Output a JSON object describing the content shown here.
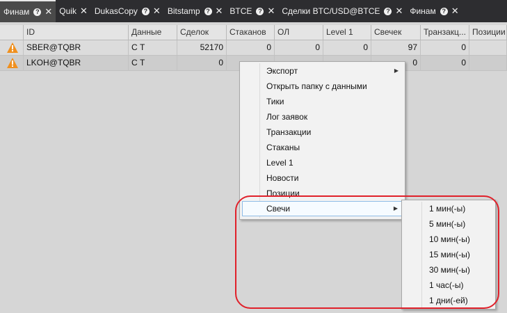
{
  "tabs": [
    {
      "label": "Финам",
      "active": true,
      "has_help": true
    },
    {
      "label": "Quik",
      "active": false,
      "has_help": false
    },
    {
      "label": "DukasCopy",
      "active": false,
      "has_help": true
    },
    {
      "label": "Bitstamp",
      "active": false,
      "has_help": true
    },
    {
      "label": "BTCE",
      "active": false,
      "has_help": true
    },
    {
      "label": "Сделки BTC/USD@BTCE",
      "active": false,
      "has_help": true
    },
    {
      "label": "Финам",
      "active": false,
      "has_help": true
    }
  ],
  "table": {
    "columns": [
      "",
      "ID",
      "Данные",
      "Сделок",
      "Стаканов",
      "ОЛ",
      "Level 1",
      "Свечек",
      "Транзакц...",
      "Позиции"
    ],
    "rows": [
      {
        "status_icon": "warning-icon",
        "id": "SBER@TQBR",
        "data": "С Т",
        "trades": "52170",
        "books": "0",
        "ol": "0",
        "level1": "0",
        "candles": "97",
        "transactions": "0",
        "positions": ""
      },
      {
        "status_icon": "warning-icon",
        "id": "LKOH@TQBR",
        "data": "С Т",
        "trades": "0",
        "books": "",
        "ol": "",
        "level1": "",
        "candles": "0",
        "transactions": "0",
        "positions": ""
      }
    ]
  },
  "context_menu": {
    "items": [
      {
        "label": "Экспорт",
        "submenu": true
      },
      {
        "label": "Открыть папку с данными",
        "submenu": false
      },
      {
        "label": "Тики",
        "submenu": false
      },
      {
        "label": "Лог заявок",
        "submenu": false
      },
      {
        "label": "Транзакции",
        "submenu": false
      },
      {
        "label": "Стаканы",
        "submenu": false
      },
      {
        "label": "Level 1",
        "submenu": false
      },
      {
        "label": "Новости",
        "submenu": false
      },
      {
        "label": "Позиции",
        "submenu": false
      },
      {
        "label": "Свечи",
        "submenu": true,
        "highlighted": true
      }
    ]
  },
  "candles_submenu": {
    "items": [
      "1 мин(-ы)",
      "5 мин(-ы)",
      "10 мин(-ы)",
      "15 мин(-ы)",
      "30 мин(-ы)",
      "1 час(-ы)",
      "1 дни(-ей)"
    ]
  },
  "colors": {
    "tab_bar": "#2d2d30",
    "highlight_border": "#8fbce6",
    "annotation": "#e0202a",
    "warning": "#f0901e"
  }
}
